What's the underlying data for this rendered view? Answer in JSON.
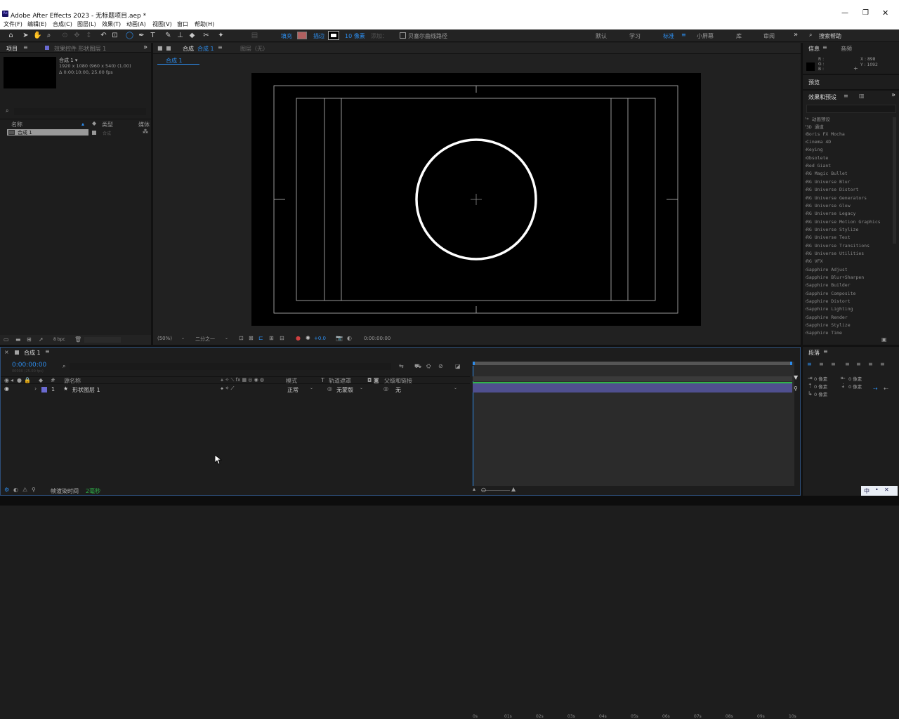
{
  "window": {
    "title": "Adobe After Effects 2023 - 无标题项目.aep *"
  },
  "menu": [
    "文件(F)",
    "编辑(E)",
    "合成(C)",
    "图层(L)",
    "效果(T)",
    "动画(A)",
    "视图(V)",
    "窗口",
    "帮助(H)"
  ],
  "toolbar": {
    "fill_label": "填充",
    "stroke_label": "描边",
    "stroke_width": "10 像素",
    "add_label": "添加：",
    "bezier_label": "贝塞尔曲线路径",
    "workspaces": [
      "默认",
      "学习",
      "标准",
      "小屏幕",
      "库",
      "审阅"
    ],
    "active_workspace": "标准",
    "search_placeholder": "搜索帮助"
  },
  "project": {
    "tab": "项目",
    "effects_tab": "效果控件 形状图层 1",
    "comp_name": "合成 1 ▾",
    "comp_res": "1920 x 1080 (960 x 540) (1.00)",
    "comp_dur": "Δ 0:00:10:00, 25.00 fps",
    "col_name": "名称",
    "col_type": "类型",
    "col_media": "媒体",
    "item_name": "合成 1",
    "item_type": "合成",
    "bpc": "8 bpc"
  },
  "viewer": {
    "tab": "合成",
    "tab_name": "合成 1",
    "layer_tab": "图层（无）",
    "breadcrumb": "合成 1",
    "zoom": "(50%)",
    "resolution": "二分之一",
    "exposure": "+0.0",
    "timecode": "0:00:00:00"
  },
  "info": {
    "tab": "信息",
    "audio_tab": "音频",
    "r": "R :",
    "g": "G :",
    "b": "B :",
    "a": "A : 0",
    "x": "X : 898",
    "y": "Y : 1092"
  },
  "preview": {
    "tab": "预览"
  },
  "effects_presets": {
    "tab": "效果和预设",
    "items": [
      "* 动画预设",
      "3D 通道",
      "Boris FX Mocha",
      "Cinema 4D",
      "Keying",
      "Obsolete",
      "Red Giant",
      "RG Magic Bullet",
      "RG Universe Blur",
      "RG Universe Distort",
      "RG Universe Generators",
      "RG Universe Glow",
      "RG Universe Legacy",
      "RG Universe Motion Graphics",
      "RG Universe Stylize",
      "RG Universe Text",
      "RG Universe Transitions",
      "RG Universe Utilities",
      "RG VFX",
      "Sapphire Adjust",
      "Sapphire Blur+Sharpen",
      "Sapphire Builder",
      "Sapphire Composite",
      "Sapphire Distort",
      "Sapphire Lighting",
      "Sapphire Render",
      "Sapphire Stylize",
      "Sapphire Time"
    ]
  },
  "timeline": {
    "tab": "合成 1",
    "timecode": "0:00:00:00",
    "timecode_sub": "00000 (25.00 fps)",
    "col_source": "源名称",
    "col_mode": "模式",
    "col_t": "T",
    "col_trkmat": "轨道遮罩",
    "col_parent": "父级和链接",
    "layer_num": "1",
    "layer_name": "形状图层 1",
    "layer_mode": "正常",
    "layer_trkmat": "无蒙版",
    "layer_parent": "无",
    "ruler": [
      "0s",
      "01s",
      "02s",
      "03s",
      "04s",
      "05s",
      "06s",
      "07s",
      "08s",
      "09s",
      "10s"
    ],
    "render_label": "帧渲染时间",
    "render_time": "2毫秒"
  },
  "paragraph": {
    "tab": "段落",
    "indent_values": [
      "0 像素",
      "0 像素",
      "0 像素",
      "0 像素",
      "0 像素"
    ]
  },
  "ime": {
    "label": "中"
  },
  "colors": {
    "accent": "#2d8ceb",
    "layer_bar": "#4f4f8f",
    "green": "#2fb54a"
  }
}
